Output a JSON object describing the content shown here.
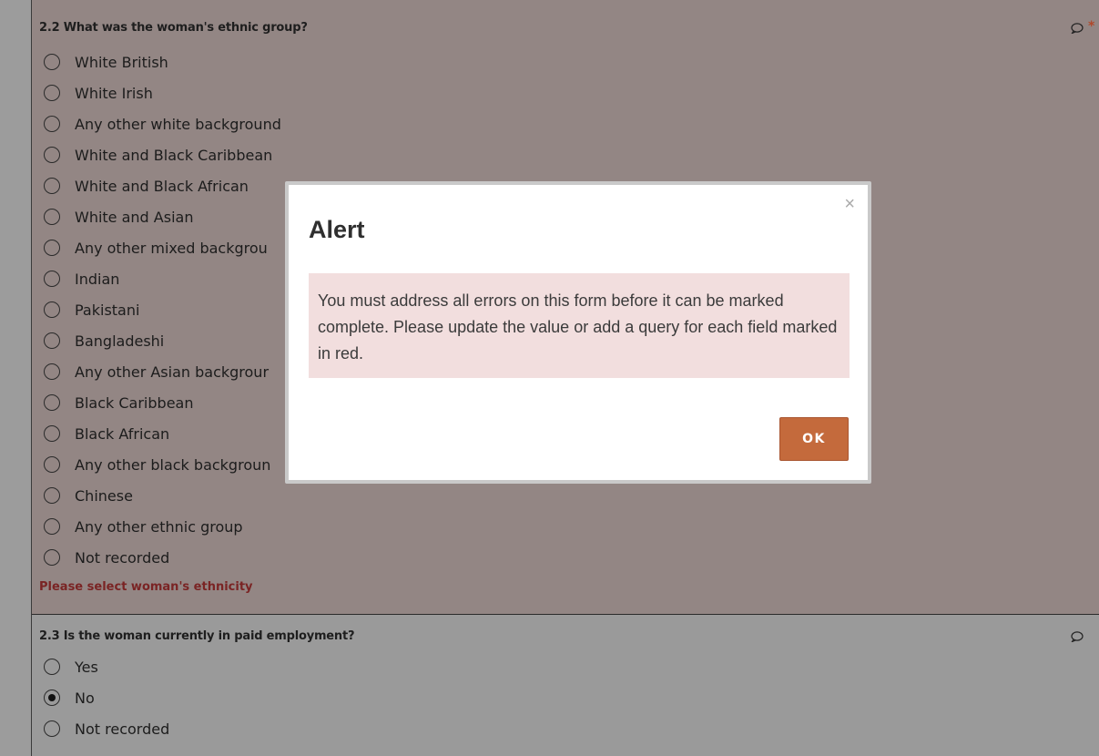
{
  "q22": {
    "title": "2.2 What was the woman's ethnic group?",
    "options": [
      "White British",
      "White Irish",
      "Any other white background",
      "White and Black Caribbean",
      "White and Black African",
      "White and Asian",
      "Any other mixed backgrou",
      "Indian",
      "Pakistani",
      "Bangladeshi",
      "Any other Asian backgrour",
      "Black Caribbean",
      "Black African",
      "Any other black backgroun",
      "Chinese",
      "Any other ethnic group",
      "Not recorded"
    ],
    "required_mark": "*",
    "error_message": "Please select woman's ethnicity"
  },
  "q23": {
    "title": "2.3 Is the woman currently in paid employment?",
    "options": [
      "Yes",
      "No",
      "Not recorded"
    ],
    "selected": "No"
  },
  "modal": {
    "close_symbol": "×",
    "title": "Alert",
    "message": "You must address all errors on this form before it can be marked complete. Please update the value or add a query for each field marked in red.",
    "ok_label": "OK"
  },
  "colors": {
    "error_bg": "#938684",
    "alert_bg": "#f2dede",
    "ok_button": "#c46a3c",
    "error_text": "#7a2424"
  },
  "icons": {
    "comment": "comment-bubble-icon"
  }
}
